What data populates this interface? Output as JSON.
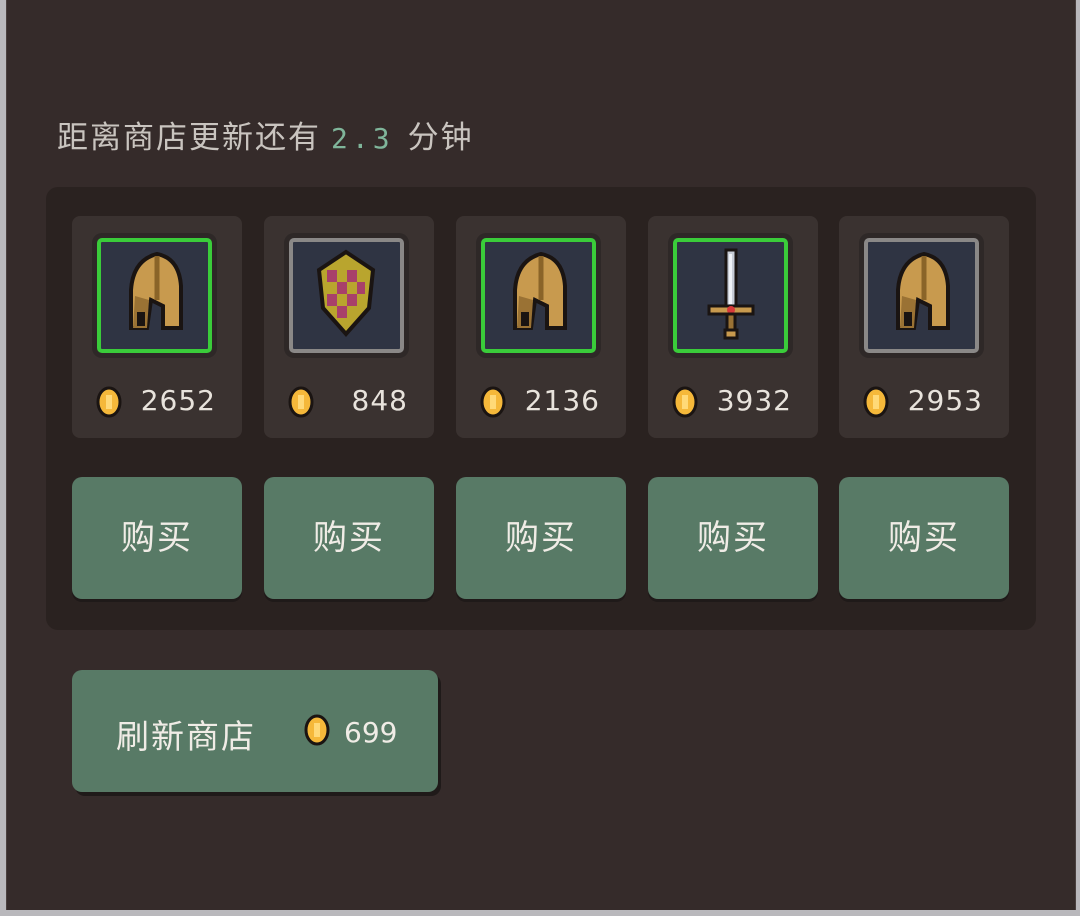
{
  "timer": {
    "prefix": "距离商店更新还有",
    "value": "2.3",
    "suffix": "分钟"
  },
  "items": [
    {
      "icon": "helmet-icon",
      "rarity_color": "#3acc3a",
      "price": "2652",
      "buy_label": "购买"
    },
    {
      "icon": "shield-icon",
      "rarity_color": "#8a8887",
      "price": "848",
      "buy_label": "购买"
    },
    {
      "icon": "helmet-icon",
      "rarity_color": "#3acc3a",
      "price": "2136",
      "buy_label": "购买"
    },
    {
      "icon": "sword-icon",
      "rarity_color": "#3acc3a",
      "price": "3932",
      "buy_label": "购买"
    },
    {
      "icon": "helmet-icon",
      "rarity_color": "#8a8887",
      "price": "2953",
      "buy_label": "购买"
    }
  ],
  "refresh": {
    "label": "刷新商店",
    "cost": "699"
  },
  "colors": {
    "button": "#587a66",
    "coin": "#f5b83a",
    "timer_value": "#7fb59a"
  }
}
